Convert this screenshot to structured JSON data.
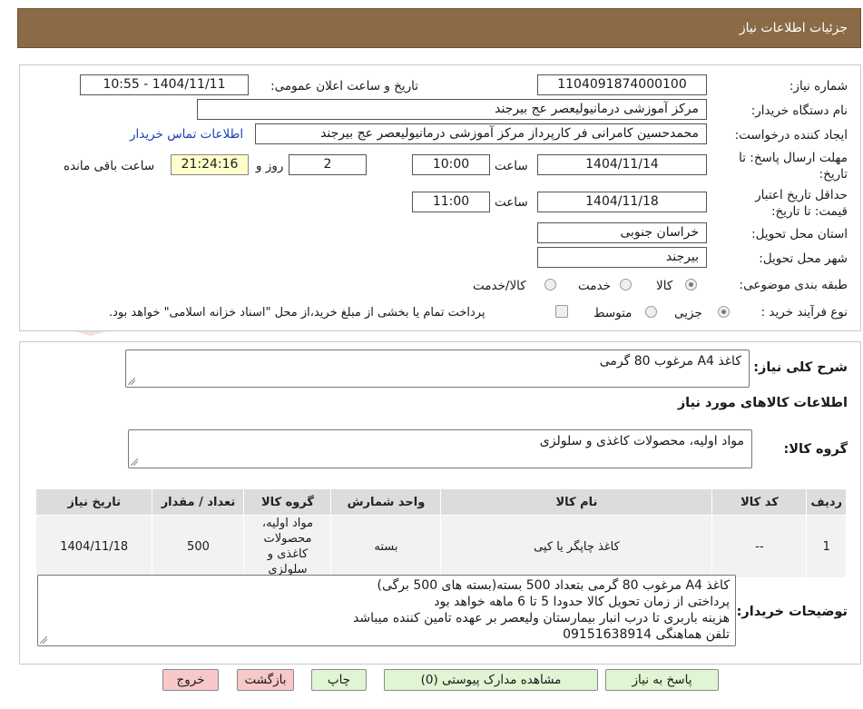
{
  "header": {
    "title": "جزئیات اطلاعات نیاز"
  },
  "watermark": {
    "text": "AriaTender.neT"
  },
  "form": {
    "need_number_label": "شماره نیاز:",
    "need_number": "1104091874000100",
    "announce_label": "تاریخ و ساعت اعلان عمومی:",
    "announce_value": "1404/11/11 - 10:55",
    "buyer_label": "نام دستگاه خریدار:",
    "buyer_value": "مرکز آموزشی درمانیولیعصر  عج  بیرجند",
    "creator_label": "ایجاد کننده درخواست:",
    "creator_value": "محمدحسین کامرانی فر کارپرداز مرکز آموزشی درمانیولیعصر  عج  بیرجند",
    "contact_link": "اطلاعات تماس خریدار",
    "send_deadline_label": "مهلت ارسال پاسخ: تا تاریخ:",
    "send_date": "1404/11/14",
    "time_label": "ساعت",
    "send_time": "10:00",
    "days_value": "2",
    "days_label": "روز و",
    "remaining_time": "21:24:16",
    "remaining_label": "ساعت باقی مانده",
    "validity_label": "حداقل تاریخ اعتبار قیمت: تا تاریخ:",
    "validity_date": "1404/11/18",
    "validity_time": "11:00",
    "province_label": "استان محل تحویل:",
    "province_value": "خراسان جنوبی",
    "city_label": "شهر محل تحویل:",
    "city_value": "بیرجند",
    "category_label": "طبقه بندی موضوعی:",
    "category_options": [
      "کالا",
      "خدمت",
      "کالا/خدمت"
    ],
    "category_selected": "کالا",
    "process_label": "نوع فرآیند خرید :",
    "process_options": [
      "جزیی",
      "متوسط"
    ],
    "process_selected": "جزیی",
    "payment_note": "پرداخت تمام یا بخشی از مبلغ خرید،از محل \"اسناد خزانه اسلامی\" خواهد بود."
  },
  "summary": {
    "label": "شرح کلی نیاز:",
    "value": "کاغذ A4 مرغوب 80 گرمی"
  },
  "goods": {
    "section_title": "اطلاعات کالاهای مورد نیاز",
    "group_label": "گروه کالا:",
    "group_value": "مواد اولیه، محصولات کاغذی و سلولزی"
  },
  "table": {
    "headers": [
      "ردیف",
      "کد کالا",
      "نام کالا",
      "واحد شمارش",
      "گروه کالا",
      "تعداد / مقدار",
      "تاریخ نیاز"
    ],
    "rows": [
      [
        "1",
        "--",
        "کاغذ چاپگر یا کپی",
        "بسته",
        "مواد اولیه، محصولات کاغذی و سلولزی",
        "500",
        "1404/11/18"
      ]
    ]
  },
  "notes": {
    "label": "توضیحات خریدار:",
    "lines": [
      "کاغذ A4 مرغوب 80 گرمی بتعداد 500 بسته(بسته های 500 برگی)",
      "پرداختی از زمان تحویل کالا حدودا 5 تا 6 ماهه خواهد بود",
      "هزینه باربری تا درب انبار بیمارستان ولیعصر بر عهده تامین کننده میباشد",
      "تلفن هماهنگی 09151638914"
    ]
  },
  "buttons": {
    "reply": "پاسخ به نیاز",
    "attachments": "مشاهده مدارک پیوستی (0)",
    "print": "چاپ",
    "back": "بازگشت",
    "exit": "خروج"
  },
  "colors": {
    "header_bg": "#8b6a46",
    "green_button": "#dff5d4",
    "pink_button": "#f8c8c8",
    "link": "#1b3fb0"
  }
}
